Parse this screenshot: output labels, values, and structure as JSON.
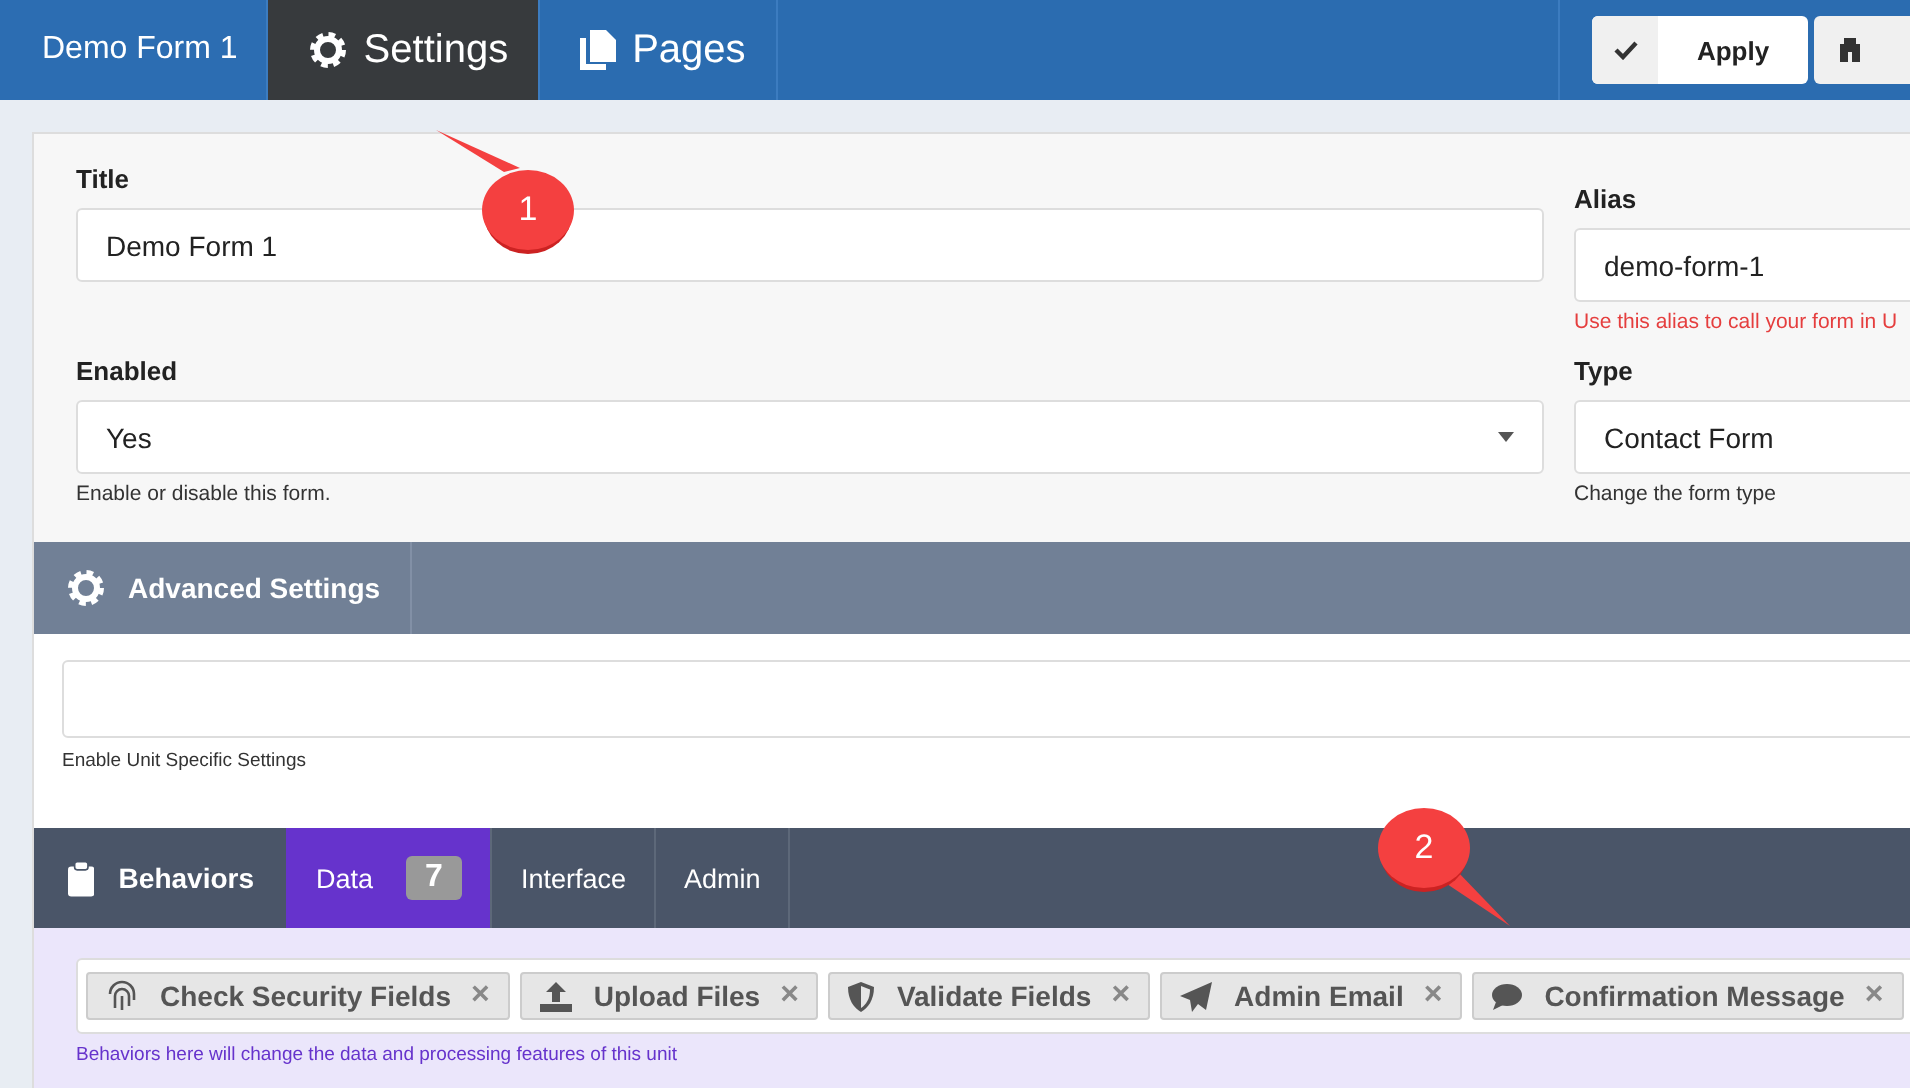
{
  "topbar": {
    "title": "Demo Form 1",
    "tabs": [
      {
        "label": "Settings",
        "selected": true
      },
      {
        "label": "Pages",
        "selected": false
      }
    ],
    "apply": "Apply"
  },
  "settings": {
    "fields": [
      {
        "label": "Title",
        "kind": "text",
        "value": "Demo Form 1"
      },
      {
        "label": "Alias",
        "kind": "text",
        "value": "demo-form-1",
        "hint": "Use this alias to call your form in U",
        "hint_error": true
      },
      {
        "label": "Enabled",
        "kind": "select",
        "value": "Yes",
        "hint": "Enable or disable this form.",
        "hint_error": false
      },
      {
        "label": "Type",
        "kind": "text",
        "value": "Contact Form",
        "hint": "Change the form type",
        "hint_error": false
      }
    ]
  },
  "advanced": {
    "title": "Advanced Settings",
    "hint": "Enable Unit Specific Settings"
  },
  "behaviors": {
    "title": "Behaviors",
    "tabs": [
      {
        "label": "Data",
        "count": "7",
        "selected": true
      },
      {
        "label": "Interface",
        "selected": false
      },
      {
        "label": "Admin",
        "selected": false
      }
    ],
    "chips": [
      {
        "label": "Check Security Fields",
        "remove": "×"
      },
      {
        "label": "Upload Files",
        "remove": "×"
      },
      {
        "label": "Validate Fields",
        "remove": "×"
      },
      {
        "label": "Admin Email",
        "remove": "×"
      },
      {
        "label": "Confirmation Message",
        "remove": "×"
      }
    ],
    "hint": "Behaviors here will change the data and processing features of this unit"
  },
  "callouts": [
    {
      "label": "1"
    },
    {
      "label": "2"
    }
  ]
}
